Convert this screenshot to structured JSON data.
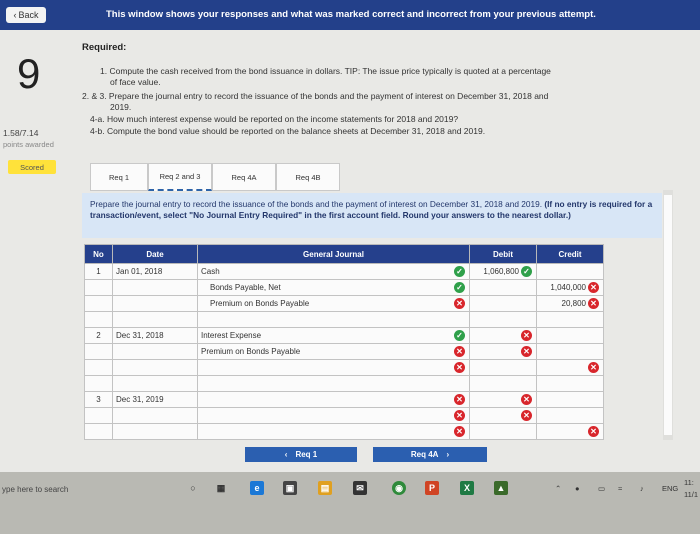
{
  "top_bar": {
    "back_label": "Back",
    "banner": "This window shows your responses and what was marked correct and incorrect from your previous attempt."
  },
  "question": {
    "number": "9",
    "score": "1.58/7.14",
    "score_label": "points awarded",
    "status": "Scored"
  },
  "requirements": {
    "title": "Required:",
    "r1": "1. Compute the cash received from the bond issuance in dollars. TIP: The issue price typically is quoted at a percentage",
    "r1b": "of face value.",
    "r2": "2. & 3. Prepare the journal entry to record the issuance of the bonds and the payment of interest on December 31, 2018 and",
    "r2b": "2019.",
    "r4a": "4-a. How much interest expense would be reported on the income statements for 2018 and 2019?",
    "r4b": "4-b. Compute the bond value should be reported on the balance sheets at December 31, 2018 and 2019."
  },
  "tabs": [
    "Req 1",
    "Req 2 and 3",
    "Req 4A",
    "Req 4B"
  ],
  "instructions": {
    "main": "Prepare the journal entry to record the issuance of the bonds and the payment of interest on December 31, 2018 and 2019.",
    "note": "(If no entry is required for a transaction/event, select \"No Journal Entry Required\" in the first account field. Round your answers to the nearest dollar.)"
  },
  "journal": {
    "headers": [
      "No",
      "Date",
      "General Journal",
      "Debit",
      "Credit"
    ],
    "rows": [
      {
        "no": "1",
        "date": "Jan 01, 2018",
        "account": "Cash",
        "indent": false,
        "acct_mark": "ok",
        "debit": "1,060,800",
        "debit_mark": "ok",
        "credit": "",
        "credit_mark": ""
      },
      {
        "no": "",
        "date": "",
        "account": "Bonds Payable, Net",
        "indent": true,
        "acct_mark": "ok",
        "debit": "",
        "debit_mark": "",
        "credit": "1,040,000",
        "credit_mark": "bad"
      },
      {
        "no": "",
        "date": "",
        "account": "Premium on Bonds Payable",
        "indent": true,
        "acct_mark": "bad",
        "debit": "",
        "debit_mark": "",
        "credit": "20,800",
        "credit_mark": "bad"
      },
      {
        "no": "",
        "date": "",
        "account": "",
        "indent": false,
        "acct_mark": "",
        "debit": "",
        "debit_mark": "",
        "credit": "",
        "credit_mark": ""
      },
      {
        "no": "2",
        "date": "Dec 31, 2018",
        "account": "Interest Expense",
        "indent": false,
        "acct_mark": "ok",
        "debit": "",
        "debit_mark": "bad",
        "credit": "",
        "credit_mark": ""
      },
      {
        "no": "",
        "date": "",
        "account": "Premium on Bonds Payable",
        "indent": false,
        "acct_mark": "bad",
        "debit": "",
        "debit_mark": "bad",
        "credit": "",
        "credit_mark": ""
      },
      {
        "no": "",
        "date": "",
        "account": "",
        "indent": false,
        "acct_mark": "bad",
        "debit": "",
        "debit_mark": "",
        "credit": "",
        "credit_mark": "bad"
      },
      {
        "no": "",
        "date": "",
        "account": "",
        "indent": false,
        "acct_mark": "",
        "debit": "",
        "debit_mark": "",
        "credit": "",
        "credit_mark": ""
      },
      {
        "no": "3",
        "date": "Dec 31, 2019",
        "account": "",
        "indent": false,
        "acct_mark": "bad",
        "debit": "",
        "debit_mark": "bad",
        "credit": "",
        "credit_mark": ""
      },
      {
        "no": "",
        "date": "",
        "account": "",
        "indent": false,
        "acct_mark": "bad",
        "debit": "",
        "debit_mark": "bad",
        "credit": "",
        "credit_mark": ""
      },
      {
        "no": "",
        "date": "",
        "account": "",
        "indent": false,
        "acct_mark": "bad",
        "debit": "",
        "debit_mark": "",
        "credit": "",
        "credit_mark": "bad"
      }
    ]
  },
  "nav": {
    "prev": "Req 1",
    "next": "Req 4A"
  },
  "taskbar": {
    "search_placeholder": "ype here to search",
    "lang": "ENG",
    "time": "11:",
    "date": "11/1"
  },
  "colors": {
    "header_blue": "#25408c",
    "correct": "#2fa04a",
    "incorrect": "#d8262c",
    "info_bg": "#d8e6f6",
    "scored_badge": "#ffe23a"
  }
}
